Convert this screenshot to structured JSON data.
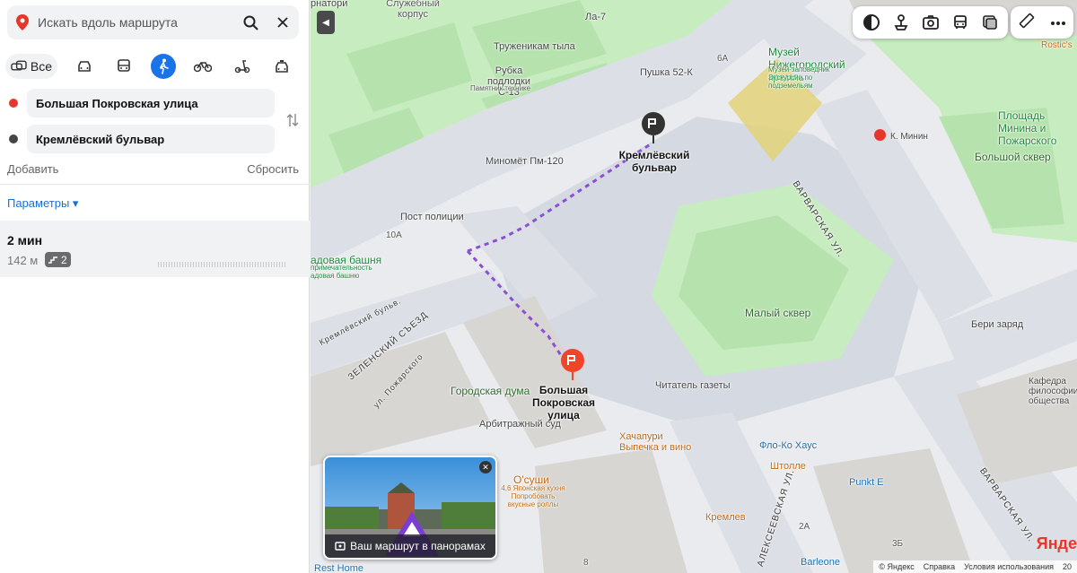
{
  "search": {
    "placeholder": "Искать вдоль маршрута"
  },
  "modes": {
    "all_label": "Все"
  },
  "route": {
    "from": "Большая Покровская улица",
    "to": "Кремлёвский бульвар",
    "add_label": "Добавить",
    "reset_label": "Сбросить",
    "params_label": "Параметры ▾",
    "result_time": "2 мин",
    "result_distance": "142 м",
    "result_stairs": "2"
  },
  "colors": {
    "accent": "#1a73e8",
    "from_dot": "#e8362b",
    "to_dot": "#444444",
    "route_line": "#8a4fd6"
  },
  "map": {
    "labels": {
      "ornatory": "рнатори",
      "service": "Служебный корпус",
      "la7": "Ла-7",
      "workers": "Труженикам тыла",
      "rubka": "Рубка подлодки С-13",
      "rubka_sub": "Памятник технике",
      "pushka": "Пушка 52-К",
      "b6a": "6А",
      "museum": "Музей Нижегородский кремль",
      "museum_sub": "Музей-заповедник Экскурсии по подземельям",
      "rostics": "Rostic's",
      "square_minin": "Площадь Минина и Пожарского",
      "k_minin": "К. Минин",
      "big_square": "Большой сквер",
      "minomet": "Миномёт Пм-120",
      "kreml_blvd": "Кремлёвский бульвар",
      "varvarskaya": "Варварская ул.",
      "post": "Пост полиции",
      "b10a": "10А",
      "tower": "адовая башня",
      "tower_sub": "примечательность адовая башню",
      "kreml_blvd_small": "Кремлёвский бульв.",
      "zelensky": "Зеленский съезд",
      "pozharskogo": "ул. Пожарского",
      "small_square": "Малый сквер",
      "beri": "Бери заряд",
      "city_duma": "Городская дума",
      "bpokrovka": "Большая Покровская улица",
      "reader": "Читатель газеты",
      "kafedra": "Кафедра философии общества",
      "arbitrazh": "Арбитражный суд",
      "khachapuri": "Хачапури Выпечка и вино",
      "flokohouse": "Фло-Ко Хаус",
      "osushi": "О'суши",
      "osushi_sub": "4,6 Японская кухня Попробовать вкусные роллы",
      "shtolle": "Штолле",
      "punkte": "Punkt E",
      "kremlev": "Кремлев",
      "alekseevskaya": "Алексеевская ул.",
      "varvarskaya2": "Варварская ул.",
      "b2a": "2А",
      "b3b": "3Б",
      "barleone": "Barleone",
      "rest_home": "Rest Home",
      "b8": "8"
    },
    "panorama_caption": "Ваш маршрут в панорамах",
    "footer": {
      "copy": "© Яндекс",
      "help": "Справка",
      "terms": "Условия использования",
      "scale": "20"
    },
    "logo": "Янде"
  }
}
